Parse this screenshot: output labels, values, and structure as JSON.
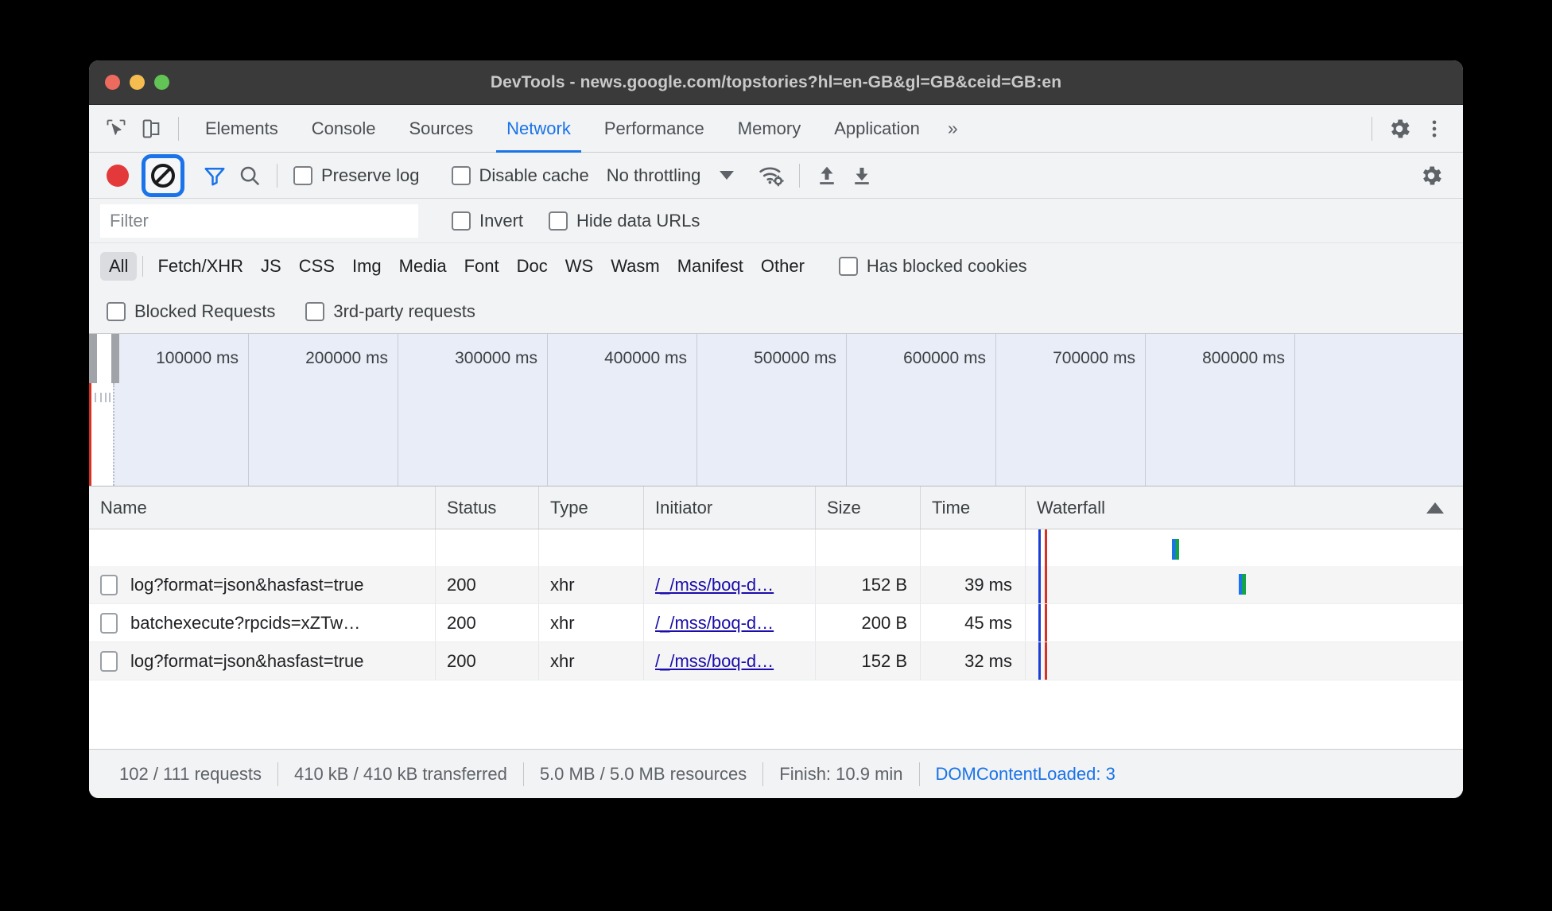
{
  "window": {
    "title": "DevTools - news.google.com/topstories?hl=en-GB&gl=GB&ceid=GB:en"
  },
  "tabstrip": {
    "inspect_icon": "inspect-cursor-icon",
    "device_icon": "device-toolbar-icon",
    "tabs": [
      {
        "label": "Elements"
      },
      {
        "label": "Console"
      },
      {
        "label": "Sources"
      },
      {
        "label": "Network"
      },
      {
        "label": "Performance"
      },
      {
        "label": "Memory"
      },
      {
        "label": "Application"
      }
    ],
    "active_tab": "Network",
    "more_tabs": "»",
    "settings_icon": "gear-icon",
    "menu_icon": "kebab-menu-icon"
  },
  "network_toolbar": {
    "record_label": "record-button",
    "clear_label": "clear-button",
    "filter_icon_label": "filter-funnel-icon",
    "search_icon_label": "search-icon",
    "preserve_log": "Preserve log",
    "disable_cache": "Disable cache",
    "throttling": "No throttling",
    "network_conditions_icon": "wifi-gear-icon",
    "import_icon": "import-har-icon",
    "export_icon": "export-har-icon",
    "settings_icon": "gear-icon"
  },
  "filter_bar": {
    "filter_placeholder": "Filter",
    "filter_value": "",
    "invert": "Invert",
    "hide_data_urls": "Hide data URLs"
  },
  "type_filters": {
    "items": [
      {
        "label": "All",
        "selected": true
      },
      {
        "label": "Fetch/XHR",
        "selected": false
      },
      {
        "label": "JS",
        "selected": false
      },
      {
        "label": "CSS",
        "selected": false
      },
      {
        "label": "Img",
        "selected": false
      },
      {
        "label": "Media",
        "selected": false
      },
      {
        "label": "Font",
        "selected": false
      },
      {
        "label": "Doc",
        "selected": false
      },
      {
        "label": "WS",
        "selected": false
      },
      {
        "label": "Wasm",
        "selected": false
      },
      {
        "label": "Manifest",
        "selected": false
      },
      {
        "label": "Other",
        "selected": false
      }
    ],
    "has_blocked_cookies": "Has blocked cookies",
    "blocked_requests": "Blocked Requests",
    "third_party_requests": "3rd-party requests"
  },
  "overview": {
    "ticks": [
      "100000 ms",
      "200000 ms",
      "300000 ms",
      "400000 ms",
      "500000 ms",
      "600000 ms",
      "700000 ms",
      "800000 ms"
    ]
  },
  "table": {
    "columns": [
      "Name",
      "Status",
      "Type",
      "Initiator",
      "Size",
      "Time",
      "Waterfall"
    ],
    "sort_column": "Waterfall",
    "sort_direction": "ascending",
    "rows": [
      {
        "name": "log?format=json&hasfast=true",
        "status": "200",
        "type": "xhr",
        "initiator": "/_/mss/boq-d…",
        "size": "152 B",
        "time": "39 ms"
      },
      {
        "name": "batchexecute?rpcids=xZTw…",
        "status": "200",
        "type": "xhr",
        "initiator": "/_/mss/boq-d…",
        "size": "200 B",
        "time": "45 ms"
      },
      {
        "name": "log?format=json&hasfast=true",
        "status": "200",
        "type": "xhr",
        "initiator": "/_/mss/boq-d…",
        "size": "152 B",
        "time": "32 ms"
      }
    ]
  },
  "statusbar": {
    "requests": "102 / 111 requests",
    "transferred": "410 kB / 410 kB transferred",
    "resources": "5.0 MB / 5.0 MB resources",
    "finish": "Finish: 10.9 min",
    "domcontentloaded": "DOMContentLoaded: 3"
  },
  "colors": {
    "accent": "#1a73e8",
    "record": "#e3393b",
    "link": "#1a0dab",
    "red_marker": "#d93025",
    "blue_marker": "#1a3fd4"
  }
}
